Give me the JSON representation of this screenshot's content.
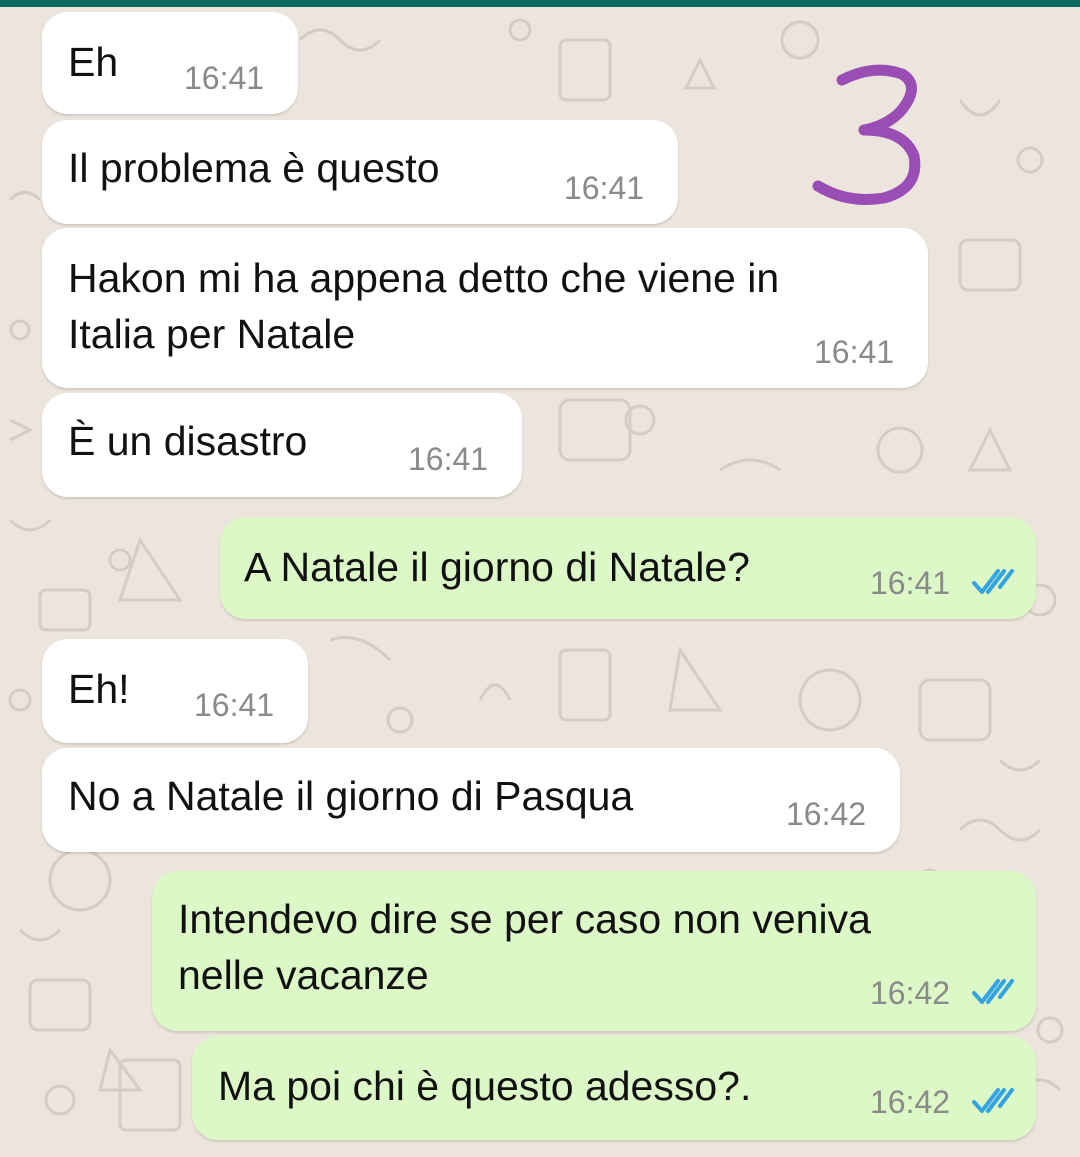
{
  "annotation": "3",
  "messages": [
    {
      "direction": "incoming",
      "text": "Eh",
      "time": "16:41"
    },
    {
      "direction": "incoming",
      "text_lines": [
        "Il problema è questo"
      ],
      "time": "16:41"
    },
    {
      "direction": "incoming",
      "text_lines": [
        "Hakon mi ha appena detto che viene in",
        "Italia per Natale"
      ],
      "time": "16:41"
    },
    {
      "direction": "incoming",
      "text": "È un disastro",
      "time": "16:41"
    },
    {
      "direction": "outgoing",
      "text": "A Natale il giorno di Natale?",
      "time": "16:41",
      "status": "read"
    },
    {
      "direction": "incoming",
      "text": "Eh!",
      "time": "16:41"
    },
    {
      "direction": "incoming",
      "text": "No a Natale il giorno di Pasqua",
      "time": "16:42"
    },
    {
      "direction": "outgoing",
      "text_lines": [
        "Intendevo dire se per caso non veniva",
        "nelle vacanze"
      ],
      "time": "16:42",
      "status": "read"
    },
    {
      "direction": "outgoing",
      "text": "Ma poi chi è questo adesso?.",
      "time": "16:42",
      "status": "read"
    }
  ],
  "colors": {
    "incoming_bubble": "#ffffff",
    "outgoing_bubble": "#dcf8c6",
    "background": "#ece5dd",
    "read_ticks": "#34a3e2",
    "annotation": "#9a4db5"
  },
  "icons": {
    "read_receipt": "double-check-icon"
  }
}
